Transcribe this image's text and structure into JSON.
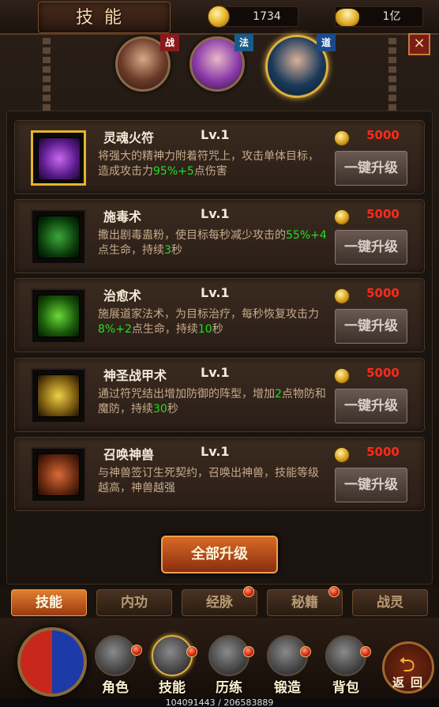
{
  "header": {
    "title": "技能",
    "gold": "1734",
    "ingot": "1亿"
  },
  "heroes": [
    {
      "badge": "战"
    },
    {
      "badge": "法"
    },
    {
      "badge": "道"
    }
  ],
  "close": "×",
  "skills": [
    {
      "name": "灵魂火符",
      "level": "Lv.1",
      "cost": "5000",
      "button": "一键升级",
      "desc": [
        "将强大的精神力附着符咒上，攻击单体目标，造成攻击力",
        "95%+5",
        "点伤害"
      ]
    },
    {
      "name": "施毒术",
      "level": "Lv.1",
      "cost": "5000",
      "button": "一键升级",
      "desc": [
        "撒出剧毒蛊粉，使目标每秒减少攻击的",
        "55%+4",
        "点生命，持续",
        "3",
        "秒"
      ]
    },
    {
      "name": "治愈术",
      "level": "Lv.1",
      "cost": "5000",
      "button": "一键升级",
      "desc": [
        "施展道家法术，为目标治疗，每秒恢复攻击力",
        "8%+2",
        "点生命，持续",
        "10",
        "秒"
      ]
    },
    {
      "name": "神圣战甲术",
      "level": "Lv.1",
      "cost": "5000",
      "button": "一键升级",
      "desc": [
        "通过符咒结出增加防御的阵型，增加",
        "2",
        "点物防和魔防，持续",
        "30",
        "秒"
      ]
    },
    {
      "name": "召唤神兽",
      "level": "Lv.1",
      "cost": "5000",
      "button": "一键升级",
      "desc": [
        "与神兽签订生死契约，召唤出神兽，技能等级越高，神兽越强"
      ]
    }
  ],
  "all_upgrade": "全部升级",
  "tabs": [
    "技能",
    "内功",
    "经脉",
    "秘籍",
    "战灵"
  ],
  "nav": [
    "角色",
    "技能",
    "历练",
    "锻造",
    "背包"
  ],
  "back": "返回",
  "exp_text": "104091443 / 206583889",
  "colors": {
    "accent": "#e0b040",
    "cost": "#ff2a1a",
    "highlight": "#20e020"
  }
}
